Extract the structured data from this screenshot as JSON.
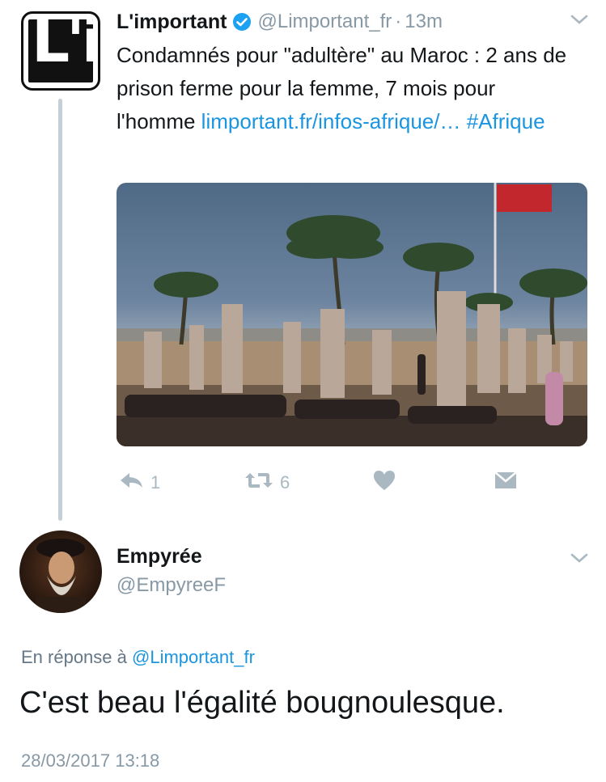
{
  "tweet": {
    "logo_text": "L'i",
    "display_name": "L'important",
    "verified_icon": "verified-badge-icon",
    "handle": "@Limportant_fr",
    "separator": "·",
    "time": "13m",
    "text_before_link": "Condamnés pour \"adultère\" au Maroc : 2 ans de prison ferme pour la femme, 7 mois pour l'homme ",
    "link_text": "limportant.fr/infos-afrique/…",
    "hashtag": "#Afrique",
    "image_alt": "Photo of palm trees and stone columns with a Moroccan flag",
    "actions": {
      "reply_count": "1",
      "retweet_count": "6",
      "like_count": "",
      "message_count": ""
    }
  },
  "reply": {
    "display_name": "Empyrée",
    "handle": "@EmpyreeF",
    "in_reply_prefix": "En réponse à",
    "in_reply_handle": "@Limportant_fr",
    "text": "C'est beau l'égalité bougnoulesque.",
    "datetime": "28/03/2017 13:18"
  },
  "colors": {
    "link": "#1b95e0",
    "verified": "#1da1f2",
    "icon_gray": "#aab8c2",
    "thread_line": "#c4cfd6"
  }
}
